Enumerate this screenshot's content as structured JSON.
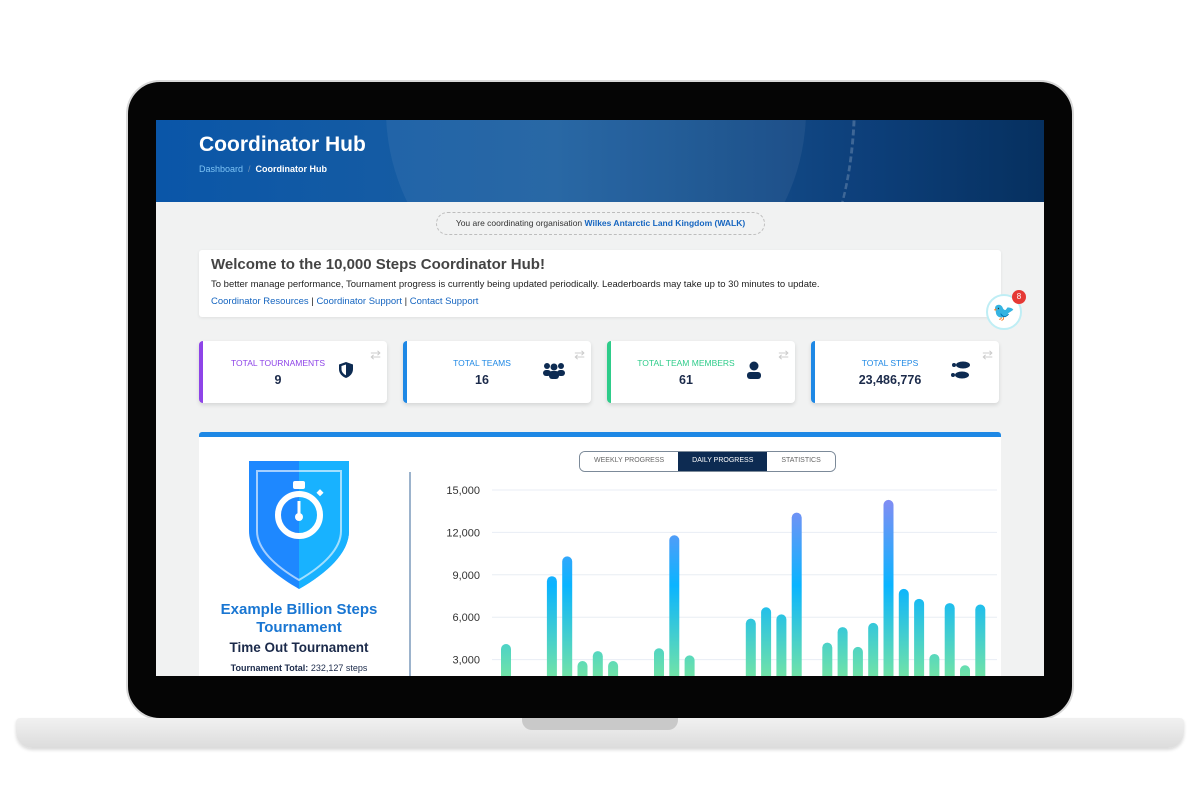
{
  "header": {
    "title": "Coordinator Hub",
    "breadcrumb": [
      "Dashboard",
      "Coordinator Hub"
    ]
  },
  "org_notice": {
    "prefix": "You are coordinating organisation",
    "org": "Wilkes Antarctic Land Kingdom (WALK)"
  },
  "welcome": {
    "title": "Welcome to the 10,000 Steps Coordinator Hub!",
    "message": "To better manage performance, Tournament progress is currently being updated periodically. Leaderboards may take up to 30 minutes to update.",
    "links": [
      "Coordinator Resources",
      "Coordinator Support",
      "Contact Support"
    ],
    "separator": "|"
  },
  "chatbot": {
    "badge": "8",
    "icon": "bird-icon"
  },
  "stats": [
    {
      "label": "TOTAL TOURNAMENTS",
      "value": "9",
      "icon": "shield-icon",
      "color": "#8e44e8"
    },
    {
      "label": "TOTAL TEAMS",
      "value": "16",
      "icon": "users-icon",
      "color": "#1e88e5"
    },
    {
      "label": "TOTAL TEAM MEMBERS",
      "value": "61",
      "icon": "user-icon",
      "color": "#2ecc8a"
    },
    {
      "label": "TOTAL STEPS",
      "value": "23,486,776",
      "icon": "footprints-icon",
      "color": "#1e88e5"
    }
  ],
  "tournament": {
    "name": "Example Billion Steps Tournament",
    "subtitle": "Time Out Tournament",
    "total_label": "Tournament Total:",
    "total_value": "232,127 steps"
  },
  "tabs": [
    {
      "label": "WEEKLY PROGRESS",
      "active": false
    },
    {
      "label": "DAILY PROGRESS",
      "active": true
    },
    {
      "label": "STATISTICS",
      "active": false
    }
  ],
  "chart_data": {
    "type": "bar",
    "ylim": [
      0,
      15000
    ],
    "yticks": [
      "15,000",
      "12,000",
      "9,000",
      "6,000",
      "3,000"
    ],
    "ytick_values": [
      15000,
      12000,
      9000,
      6000,
      3000
    ],
    "grid": true,
    "values": [
      4100,
      0,
      200,
      8900,
      10300,
      2900,
      3600,
      2900,
      0,
      800,
      3800,
      11800,
      3300,
      0,
      0,
      0,
      5900,
      6700,
      6200,
      13400,
      0,
      4200,
      5300,
      3900,
      5600,
      14300,
      8000,
      7300,
      3400,
      7000,
      2600,
      6900
    ],
    "colors": {
      "low": "#8ef08f",
      "mid": "#0ab4ff",
      "high": "#8f88f2"
    }
  }
}
